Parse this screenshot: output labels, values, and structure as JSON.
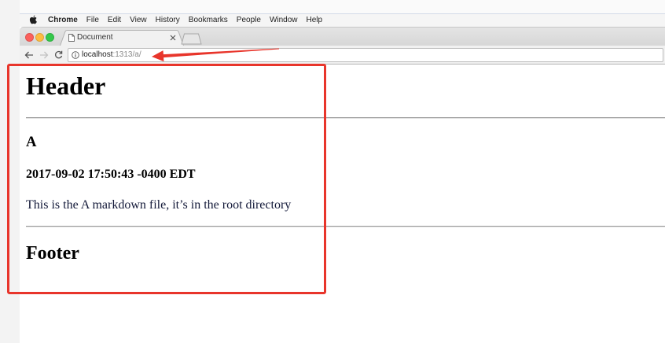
{
  "menubar": {
    "apple_icon": "apple-logo-icon",
    "app_name": "Chrome",
    "items": [
      "File",
      "Edit",
      "View",
      "History",
      "Bookmarks",
      "People",
      "Window",
      "Help"
    ]
  },
  "window": {
    "traffic_lights": {
      "close": "#fc605c",
      "minimize": "#fdbc40",
      "zoom": "#34c84a"
    },
    "tabs": [
      {
        "title": "Document",
        "icon": "page-icon",
        "close_icon": "close-icon",
        "active": true
      }
    ],
    "new_tab_icon": "new-tab-icon"
  },
  "toolbar": {
    "back_icon": "arrow-left-icon",
    "forward_icon": "arrow-right-icon",
    "forward_enabled": false,
    "reload_icon": "reload-icon",
    "omnibox": {
      "security_icon": "info-icon",
      "host": "localhost",
      "path": ":1313/a/"
    }
  },
  "page": {
    "header": "Header",
    "title": "A",
    "date": "2017-09-02 17:50:43 -0400 EDT",
    "content": "This is the A markdown file, it’s in the root directory",
    "footer": "Footer"
  },
  "annotations": {
    "color": "#e8352b"
  }
}
